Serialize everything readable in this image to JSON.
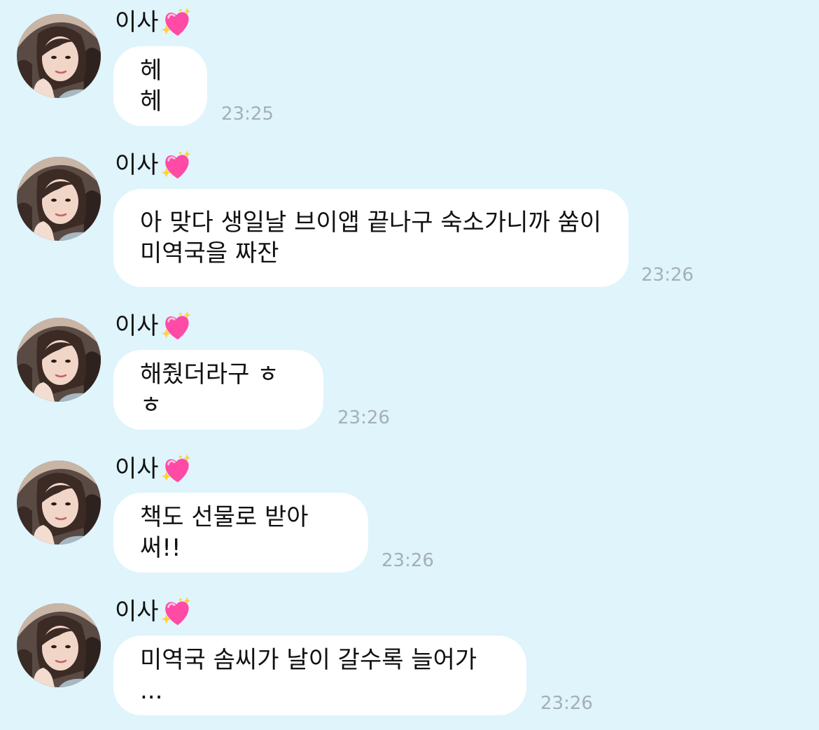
{
  "sender": {
    "name": "이사",
    "icon": "sparkling-heart-icon",
    "heart_color": "#ff3fa4"
  },
  "messages": [
    {
      "text": "헤헤",
      "time": "23:25"
    },
    {
      "text": "아 맞다 생일날 브이앱 끝나구 숙소가니까 쑴이\n미역국을 짜잔",
      "time": "23:26"
    },
    {
      "text": "해줬더라구 ㅎㅎ",
      "time": "23:26"
    },
    {
      "text": "책도 선물로 받아써!!",
      "time": "23:26"
    },
    {
      "text": "미역국 솜씨가 날이 갈수록 늘어가 ...",
      "time": "23:26"
    }
  ],
  "colors": {
    "background": "#dff4fb",
    "bubble": "#ffffff",
    "timestamp": "#a4b0b6"
  }
}
